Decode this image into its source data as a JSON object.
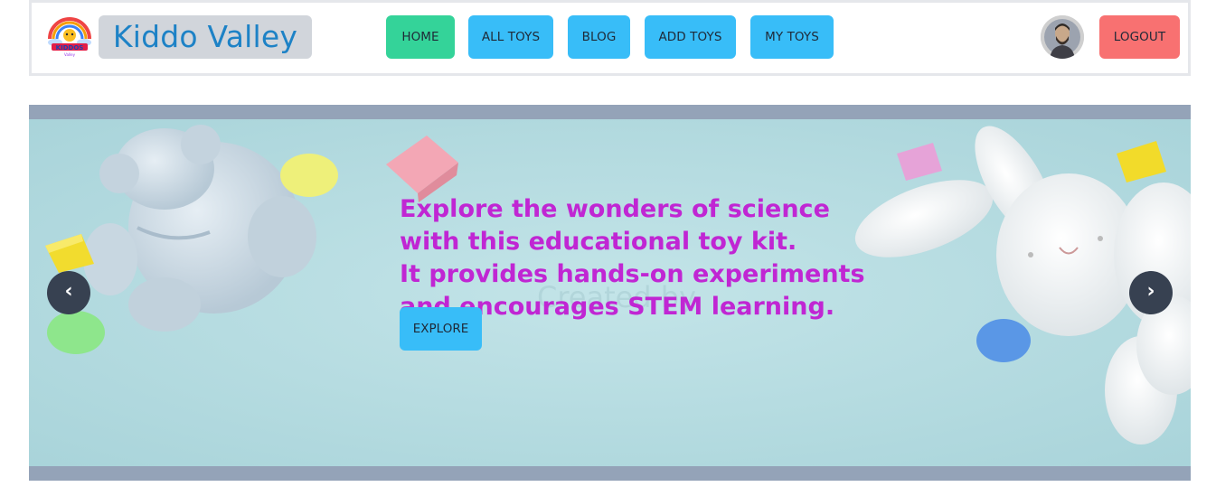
{
  "header": {
    "brand_name": "Kiddo Valley",
    "nav": {
      "home": "HOME",
      "all_toys": "ALL TOYS",
      "blog": "BLOG",
      "add_toys": "ADD TOYS",
      "my_toys": "MY TOYS"
    },
    "logout_label": "LOGOUT"
  },
  "hero": {
    "headline_lines": [
      "Explore the wonders of science",
      "with this educational toy kit.",
      "It provides hands-on experiments",
      "and encourages STEM learning."
    ],
    "button_label": "EXPLORE",
    "prev_icon": "chevron-left-icon",
    "next_icon": "chevron-right-icon"
  },
  "colors": {
    "brand_text": "#1d82c6",
    "home_button": "#34d399",
    "nav_button": "#38bdf8",
    "logout_button": "#f87171",
    "headline": "#c026d3",
    "arrow_bg": "#374151"
  }
}
